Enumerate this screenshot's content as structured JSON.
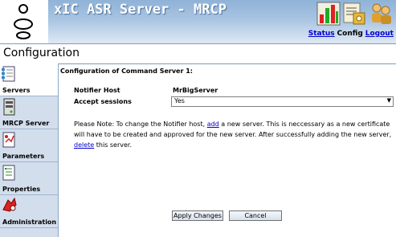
{
  "app": {
    "title": "xIC ASR Server - MRCP"
  },
  "header_links": {
    "status": "Status",
    "config": "Config",
    "logout": "Logout"
  },
  "header_icons": [
    "status-chart-icon",
    "config-tools-icon",
    "logout-users-icon"
  ],
  "page": {
    "title": "Configuration"
  },
  "sidebar": {
    "items": [
      {
        "label": "Servers",
        "icon": "servers-icon",
        "active": true
      },
      {
        "label": "MRCP Server",
        "icon": "mrcp-server-icon",
        "active": false
      },
      {
        "label": "Parameters",
        "icon": "parameters-icon",
        "active": false
      },
      {
        "label": "Properties",
        "icon": "properties-icon",
        "active": false
      },
      {
        "label": "Administration",
        "icon": "administration-icon",
        "active": false
      }
    ]
  },
  "main": {
    "heading": "Configuration of Command Server 1:",
    "notifier_host_label": "Notifier Host",
    "notifier_host_value": "MrBigServer",
    "accept_sessions_label": "Accept sessions",
    "accept_sessions_value": "Yes",
    "note": {
      "part1": "Please Note: To change the Notifier host, ",
      "link_add": "add",
      "part2": " a new server. This is neccessary as a new certificate will have to be created and approved for the new server. After successfully adding the new server, ",
      "link_delete": "delete",
      "part3": " this server."
    },
    "apply_button": "Apply Changes",
    "cancel_button": "Cancel"
  },
  "colors": {
    "header_gradient_top": "#8fb2d7",
    "sidebar_bg": "#d3deec",
    "link": "#0000cc"
  }
}
